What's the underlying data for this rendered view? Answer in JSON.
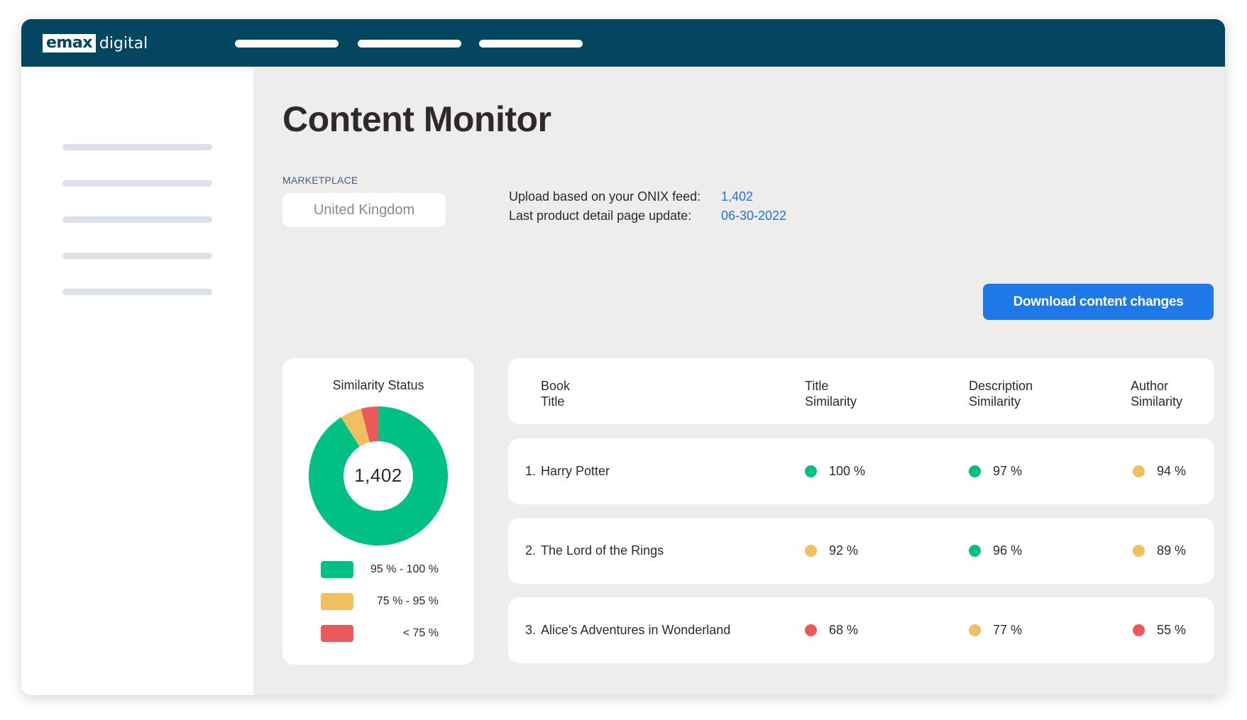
{
  "brand": {
    "logo_box": "emax",
    "logo_text": "digital"
  },
  "page": {
    "title": "Content Monitor",
    "marketplace_label": "MARKETPLACE",
    "marketplace_value": "United Kingdom",
    "upload_label": "Upload based on your ONIX feed:",
    "upload_value": "1,402",
    "update_label": "Last product detail page update:",
    "update_value": "06-30-2022",
    "download_button": "Download content changes"
  },
  "colors": {
    "green": "#00c084",
    "yellow": "#f0c060",
    "red": "#ea5a5a",
    "navy": "#04465f",
    "accent_blue": "#1f78e8"
  },
  "chart": {
    "title": "Similarity Status",
    "center_value": "1,402",
    "legend": [
      {
        "label": "95 % - 100 %",
        "color": "#00c084"
      },
      {
        "label": "75 %  -  95 %",
        "color": "#f0c060"
      },
      {
        "label": "< 75 %",
        "color": "#ea5a5a"
      }
    ]
  },
  "chart_data": {
    "type": "pie",
    "title": "Similarity Status",
    "categories": [
      "95 % - 100 %",
      "75 %  -  95 %",
      "< 75 %"
    ],
    "values": [
      91,
      5,
      4
    ],
    "colors": [
      "#00c084",
      "#f0c060",
      "#ea5a5a"
    ],
    "center_label": "1,402"
  },
  "table": {
    "headers": [
      [
        "Book",
        "Title"
      ],
      [
        "Title",
        "Similarity"
      ],
      [
        "Description",
        "Similarity"
      ],
      [
        "Author",
        "Similarity"
      ]
    ],
    "rows": [
      {
        "index": "1.",
        "title": "Harry Potter",
        "title_sim": "100 %",
        "title_color": "#00c084",
        "desc_sim": "97 %",
        "desc_color": "#00c084",
        "author_sim": "94 %",
        "author_color": "#f0c060"
      },
      {
        "index": "2.",
        "title": "The Lord of the Rings",
        "title_sim": "92 %",
        "title_color": "#f0c060",
        "desc_sim": "96 %",
        "desc_color": "#00c084",
        "author_sim": "89 %",
        "author_color": "#f0c060"
      },
      {
        "index": "3.",
        "title": "Alice's Adventures in Wonderland",
        "title_sim": "68 %",
        "title_color": "#ea5a5a",
        "desc_sim": "77 %",
        "desc_color": "#f0c060",
        "author_sim": "55 %",
        "author_color": "#ea5a5a"
      }
    ]
  }
}
